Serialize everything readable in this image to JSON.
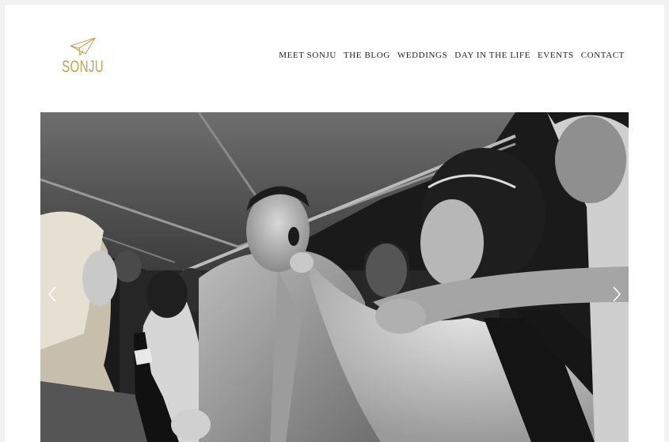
{
  "brand": {
    "name": "SONJU",
    "logo_icon": "paper-plane-icon",
    "accent_color": "#c2a253"
  },
  "nav": {
    "items": [
      {
        "label": "MEET SONJU"
      },
      {
        "label": "THE BLOG"
      },
      {
        "label": "WEDDINGS"
      },
      {
        "label": "DAY IN THE LIFE"
      },
      {
        "label": "EVENTS"
      },
      {
        "label": "CONTACT"
      }
    ]
  },
  "slideshow": {
    "image": "black-and-white wedding reception photo under a tent: a man in a light suit making a surprised face while a woman holds his chin, guests around",
    "prev_icon": "chevron-left-icon",
    "next_icon": "chevron-right-icon"
  }
}
